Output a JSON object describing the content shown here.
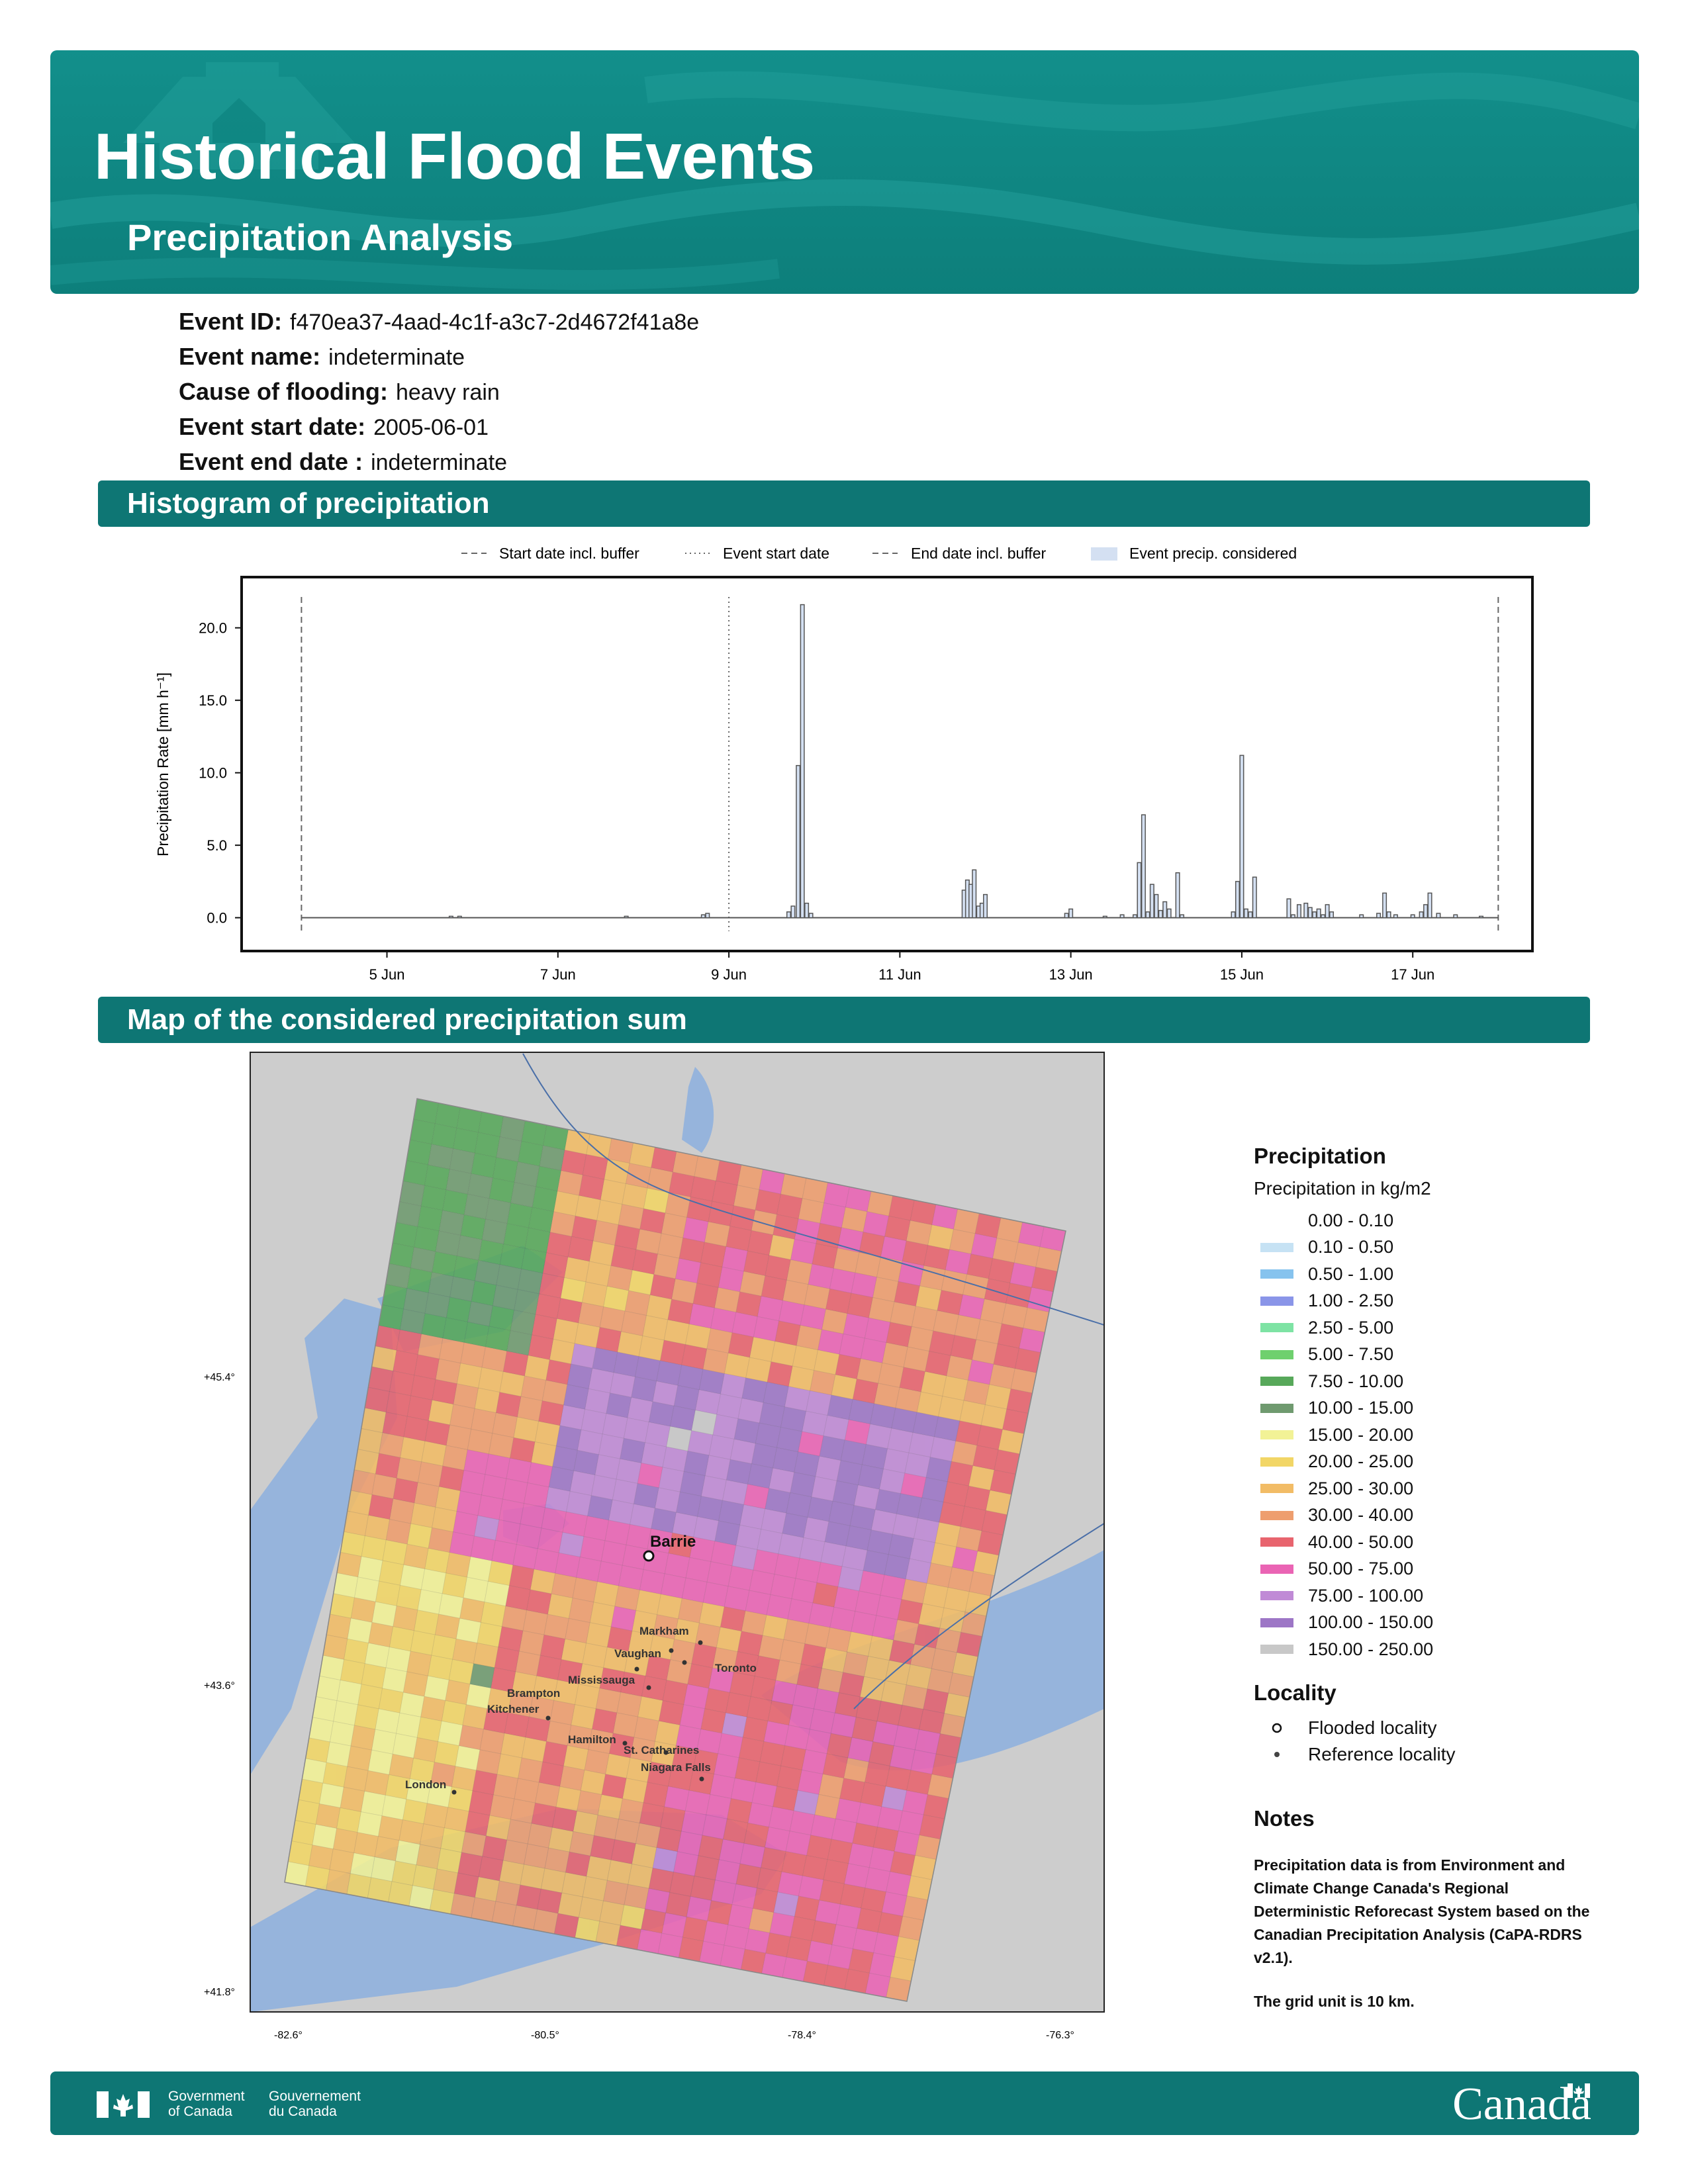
{
  "banner": {
    "title": "Historical Flood Events",
    "subtitle": "Precipitation Analysis"
  },
  "event": {
    "id_label": "Event ID:",
    "id_value": "f470ea37-4aad-4c1f-a3c7-2d4672f41a8e",
    "name_label": "Event name:",
    "name_value": "indeterminate",
    "cause_label": "Cause of flooding:",
    "cause_value": "heavy rain",
    "start_label": "Event start date:",
    "start_value": "2005-06-01",
    "end_label": "Event end date :",
    "end_value": "indeterminate"
  },
  "sections": {
    "histogram": "Histogram of precipitation",
    "map": "Map of the considered precipitation sum"
  },
  "chart_data": {
    "type": "bar",
    "ylabel": "Precipitation Rate [mm h⁻¹]",
    "xlabel": "",
    "x_domain_days": [
      3.3,
      18.4
    ],
    "ylim": [
      -2.3,
      23.5
    ],
    "yticks": [
      0,
      5,
      10,
      15,
      20
    ],
    "ytick_labels": [
      "0.0",
      "5.0",
      "10.0",
      "15.0",
      "20.0"
    ],
    "xticks": [
      5,
      7,
      9,
      11,
      13,
      15,
      17
    ],
    "xtick_labels": [
      "5 Jun",
      "7 Jun",
      "9 Jun",
      "11 Jun",
      "13 Jun",
      "15 Jun",
      "17 Jun"
    ],
    "grid": false,
    "legend": {
      "placement": "top",
      "entries": [
        "Start date incl. buffer",
        "Event start date",
        "End date incl. buffer",
        "Event precip. considered"
      ]
    },
    "vlines": [
      {
        "label": "Start date incl. buffer",
        "day": 4.0,
        "style": "dashed"
      },
      {
        "label": "Event start date",
        "day": 9.0,
        "style": "dotted"
      },
      {
        "label": "End date incl. buffer",
        "day": 18.0,
        "style": "dashed"
      }
    ],
    "series": [
      {
        "name": "Event precip. considered",
        "points": [
          [
            5.75,
            0.1
          ],
          [
            5.85,
            0.1
          ],
          [
            7.8,
            0.1
          ],
          [
            8.7,
            0.2
          ],
          [
            8.75,
            0.3
          ],
          [
            9.7,
            0.4
          ],
          [
            9.75,
            0.8
          ],
          [
            9.81,
            10.5
          ],
          [
            9.86,
            21.6
          ],
          [
            9.91,
            1.0
          ],
          [
            9.96,
            0.3
          ],
          [
            11.75,
            1.9
          ],
          [
            11.79,
            2.6
          ],
          [
            11.83,
            2.3
          ],
          [
            11.87,
            3.3
          ],
          [
            11.92,
            0.8
          ],
          [
            11.96,
            1.0
          ],
          [
            12.0,
            1.6
          ],
          [
            12.95,
            0.3
          ],
          [
            13.0,
            0.6
          ],
          [
            13.4,
            0.1
          ],
          [
            13.6,
            0.2
          ],
          [
            13.75,
            0.2
          ],
          [
            13.8,
            3.8
          ],
          [
            13.85,
            7.1
          ],
          [
            13.9,
            0.4
          ],
          [
            13.95,
            2.3
          ],
          [
            14.0,
            1.6
          ],
          [
            14.05,
            0.5
          ],
          [
            14.1,
            1.1
          ],
          [
            14.15,
            0.6
          ],
          [
            14.25,
            3.1
          ],
          [
            14.3,
            0.2
          ],
          [
            14.9,
            0.4
          ],
          [
            14.95,
            2.5
          ],
          [
            15.0,
            11.2
          ],
          [
            15.05,
            0.6
          ],
          [
            15.1,
            0.4
          ],
          [
            15.15,
            2.8
          ],
          [
            15.55,
            1.3
          ],
          [
            15.6,
            0.2
          ],
          [
            15.67,
            0.9
          ],
          [
            15.75,
            1.0
          ],
          [
            15.8,
            0.7
          ],
          [
            15.85,
            0.4
          ],
          [
            15.9,
            0.6
          ],
          [
            15.95,
            0.2
          ],
          [
            16.0,
            0.9
          ],
          [
            16.05,
            0.4
          ],
          [
            16.4,
            0.2
          ],
          [
            16.6,
            0.3
          ],
          [
            16.67,
            1.7
          ],
          [
            16.72,
            0.4
          ],
          [
            16.8,
            0.2
          ],
          [
            17.0,
            0.2
          ],
          [
            17.1,
            0.4
          ],
          [
            17.15,
            0.9
          ],
          [
            17.2,
            1.7
          ],
          [
            17.3,
            0.3
          ],
          [
            17.5,
            0.2
          ],
          [
            17.8,
            0.1
          ]
        ]
      }
    ]
  },
  "map": {
    "lat_labels": [
      "+45.4°",
      "+43.6°",
      "+41.8°"
    ],
    "lon_labels": [
      "-82.6°",
      "-80.5°",
      "-78.4°",
      "-76.3°"
    ],
    "flooded_locality": "Barrie",
    "reference_localities": [
      "Markham",
      "Vaughan",
      "Toronto",
      "Mississauga",
      "Brampton",
      "Kitchener",
      "Hamilton",
      "St. Catharines",
      "Niagara Falls",
      "London"
    ],
    "colors": {
      "land": "#cdcdcd",
      "water": "#96b4dc"
    }
  },
  "legend": {
    "title": "Precipitation",
    "subtitle": "Precipitation in kg/m2",
    "bins": [
      {
        "label": "0.00 - 0.10",
        "color": "#ffffff"
      },
      {
        "label": "0.10 - 0.50",
        "color": "#c6e2f4"
      },
      {
        "label": "0.50 - 1.00",
        "color": "#86c3ee"
      },
      {
        "label": "1.00 - 2.50",
        "color": "#8a95e8"
      },
      {
        "label": "2.50 - 5.00",
        "color": "#7ee3a4"
      },
      {
        "label": "5.00 - 7.50",
        "color": "#6fd06e"
      },
      {
        "label": "7.50 - 10.00",
        "color": "#57a85a"
      },
      {
        "label": "10.00 - 15.00",
        "color": "#6f9a6f"
      },
      {
        "label": "15.00 - 20.00",
        "color": "#f2f296"
      },
      {
        "label": "20.00 - 25.00",
        "color": "#f2d666"
      },
      {
        "label": "25.00 - 30.00",
        "color": "#f2bc66"
      },
      {
        "label": "30.00 - 40.00",
        "color": "#ee9e6e"
      },
      {
        "label": "40.00 - 50.00",
        "color": "#e8646e"
      },
      {
        "label": "50.00 - 75.00",
        "color": "#ea64b4"
      },
      {
        "label": "75.00 - 100.00",
        "color": "#c08ad6"
      },
      {
        "label": "100.00 - 150.00",
        "color": "#9d76c6"
      },
      {
        "label": "150.00 - 250.00",
        "color": "#c8c8c8"
      }
    ],
    "locality_title": "Locality",
    "flooded_label": "Flooded locality",
    "reference_label": "Reference locality"
  },
  "notes": {
    "title": "Notes",
    "text": "Precipitation data is from Environment and Climate Change Canada's Regional Deterministic Reforecast System based on the Canadian Precipitation Analysis (CaPA-RDRS v2.1).",
    "grid_text": "The grid unit is 10 km."
  },
  "footer": {
    "gov_en_1": "Government",
    "gov_en_2": "of Canada",
    "gov_fr_1": "Gouvernement",
    "gov_fr_2": "du Canada",
    "wordmark": "Canada"
  }
}
